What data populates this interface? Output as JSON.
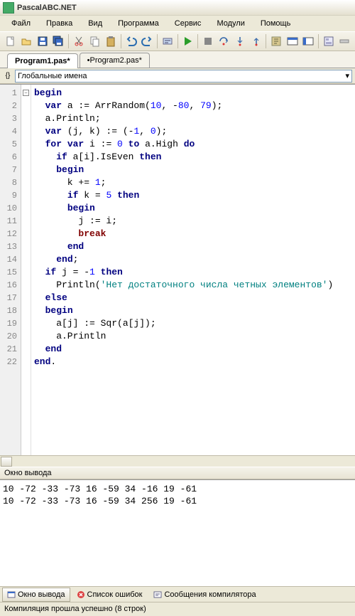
{
  "window": {
    "title": "PascalABC.NET"
  },
  "menu": {
    "items": [
      "Файл",
      "Правка",
      "Вид",
      "Программа",
      "Сервис",
      "Модули",
      "Помощь"
    ]
  },
  "tabs": [
    {
      "label": "Program1.pas*",
      "active": true
    },
    {
      "label": "•Program2.pas*",
      "active": false
    }
  ],
  "scope": {
    "label": "Глобальные имена"
  },
  "code": {
    "line_count": 22,
    "lines": [
      [
        [
          "kw",
          "begin"
        ]
      ],
      [
        [
          "pl",
          "  "
        ],
        [
          "kw",
          "var"
        ],
        [
          "pl",
          " a := ArrRandom("
        ],
        [
          "num",
          "10"
        ],
        [
          "pl",
          ", -"
        ],
        [
          "num",
          "80"
        ],
        [
          "pl",
          ", "
        ],
        [
          "num",
          "79"
        ],
        [
          "pl",
          ");"
        ]
      ],
      [
        [
          "pl",
          "  a.Println;"
        ]
      ],
      [
        [
          "pl",
          "  "
        ],
        [
          "kw",
          "var"
        ],
        [
          "pl",
          " (j, k) := (-"
        ],
        [
          "num",
          "1"
        ],
        [
          "pl",
          ", "
        ],
        [
          "num",
          "0"
        ],
        [
          "pl",
          ");"
        ]
      ],
      [
        [
          "pl",
          "  "
        ],
        [
          "kw",
          "for"
        ],
        [
          "pl",
          " "
        ],
        [
          "kw",
          "var"
        ],
        [
          "pl",
          " i := "
        ],
        [
          "num",
          "0"
        ],
        [
          "pl",
          " "
        ],
        [
          "kw",
          "to"
        ],
        [
          "pl",
          " a.High "
        ],
        [
          "kw",
          "do"
        ]
      ],
      [
        [
          "pl",
          "    "
        ],
        [
          "kw",
          "if"
        ],
        [
          "pl",
          " a[i].IsEven "
        ],
        [
          "kw",
          "then"
        ]
      ],
      [
        [
          "pl",
          "    "
        ],
        [
          "kw",
          "begin"
        ]
      ],
      [
        [
          "pl",
          "      k += "
        ],
        [
          "num",
          "1"
        ],
        [
          "pl",
          ";"
        ]
      ],
      [
        [
          "pl",
          "      "
        ],
        [
          "kw",
          "if"
        ],
        [
          "pl",
          " k = "
        ],
        [
          "num",
          "5"
        ],
        [
          "pl",
          " "
        ],
        [
          "kw",
          "then"
        ]
      ],
      [
        [
          "pl",
          "      "
        ],
        [
          "kw",
          "begin"
        ]
      ],
      [
        [
          "pl",
          "        j := i;"
        ]
      ],
      [
        [
          "pl",
          "        "
        ],
        [
          "brk",
          "break"
        ]
      ],
      [
        [
          "pl",
          "      "
        ],
        [
          "kw",
          "end"
        ]
      ],
      [
        [
          "pl",
          "    "
        ],
        [
          "kw",
          "end"
        ],
        [
          "pl",
          ";"
        ]
      ],
      [
        [
          "pl",
          "  "
        ],
        [
          "kw",
          "if"
        ],
        [
          "pl",
          " j = -"
        ],
        [
          "num",
          "1"
        ],
        [
          "pl",
          " "
        ],
        [
          "kw",
          "then"
        ]
      ],
      [
        [
          "pl",
          "    Println("
        ],
        [
          "str",
          "'Нет достаточного числа четных элементов'"
        ],
        [
          "pl",
          ")"
        ]
      ],
      [
        [
          "pl",
          "  "
        ],
        [
          "kw",
          "else"
        ]
      ],
      [
        [
          "pl",
          "  "
        ],
        [
          "kw",
          "begin"
        ]
      ],
      [
        [
          "pl",
          "    a[j] := Sqr(a[j]);"
        ]
      ],
      [
        [
          "pl",
          "    a.Println"
        ]
      ],
      [
        [
          "pl",
          "  "
        ],
        [
          "kw",
          "end"
        ]
      ],
      [
        [
          "kw",
          "end"
        ],
        [
          "pl",
          "."
        ]
      ]
    ]
  },
  "output": {
    "title": "Окно вывода",
    "lines": [
      "10 -72 -33 -73 16 -59 34 -16 19 -61",
      "10 -72 -33 -73 16 -59 34 256 19 -61"
    ]
  },
  "bottom_tabs": [
    {
      "label": "Окно вывода",
      "icon": "window",
      "active": true
    },
    {
      "label": "Список ошибок",
      "icon": "error",
      "active": false
    },
    {
      "label": "Сообщения компилятора",
      "icon": "msg",
      "active": false
    }
  ],
  "status": {
    "text": "Компиляция прошла успешно (8 строк)"
  },
  "toolbar_icons": [
    "new-file",
    "open-file",
    "save",
    "save-all",
    "sep",
    "cut",
    "copy",
    "paste",
    "sep",
    "undo",
    "redo",
    "sep",
    "intellisense",
    "sep",
    "run",
    "sep",
    "stop",
    "step-over",
    "step-into",
    "step-out",
    "sep",
    "compile",
    "mode-1",
    "mode-2",
    "sep",
    "form-designer",
    "collapse"
  ],
  "colors": {
    "run": "#2a9d2a",
    "save": "#3a6cc8",
    "undo": "#2a6db0",
    "stop": "#888"
  }
}
